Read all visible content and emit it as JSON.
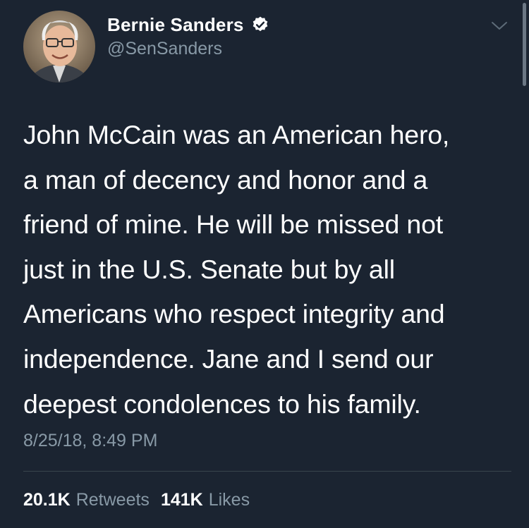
{
  "author": {
    "display_name": "Bernie Sanders",
    "handle": "@SenSanders",
    "verified_icon": "verified-badge-icon"
  },
  "tweet": {
    "text": "John McCain was an American hero,\na man of decency and honor and a\nfriend of mine. He will be missed not\njust in the U.S. Senate but by all\nAmericans who respect integrity and\nindependence. Jane and I send our\ndeepest condolences to his family.",
    "timestamp": "8/25/18, 8:49 PM"
  },
  "stats": {
    "retweets_count": "20.1K",
    "retweets_label": "Retweets",
    "likes_count": "141K",
    "likes_label": "Likes"
  },
  "colors": {
    "background": "#1b2431",
    "text_primary": "#ffffff",
    "text_secondary": "#8899a6",
    "divider": "#38444d"
  }
}
